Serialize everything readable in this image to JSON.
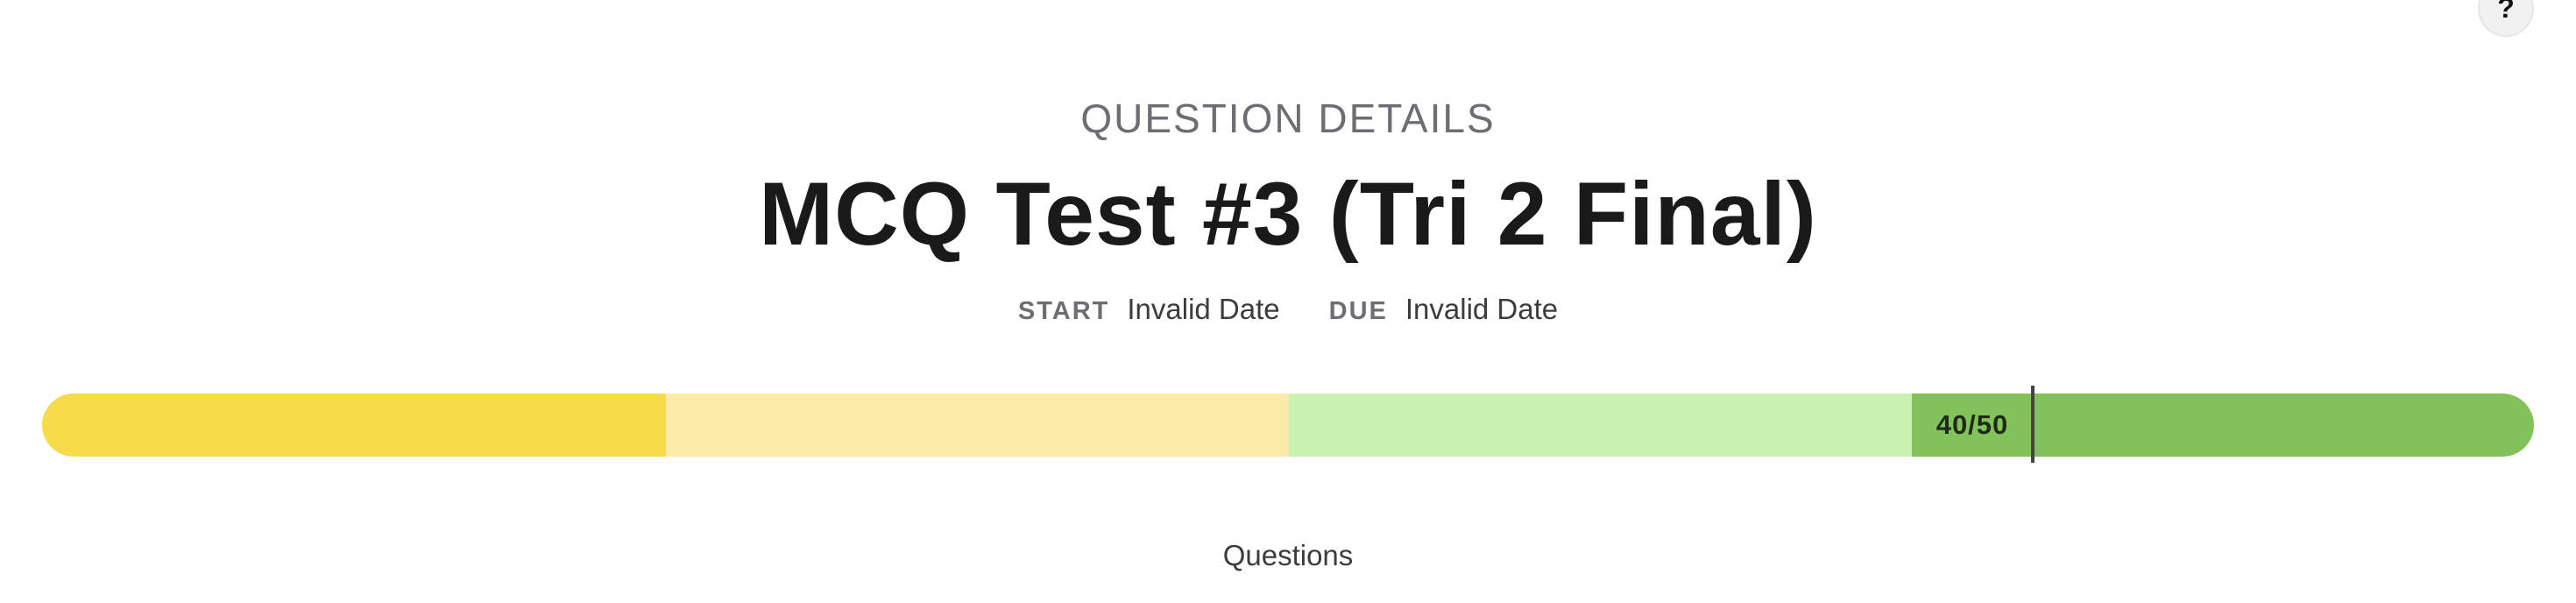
{
  "help": {
    "label": "?"
  },
  "header": {
    "section_label": "QUESTION DETAILS",
    "title": "MCQ Test #3 (Tri 2 Final)"
  },
  "dates": {
    "start_key": "START",
    "start_value": "Invalid Date",
    "due_key": "DUE",
    "due_value": "Invalid Date"
  },
  "progress": {
    "score_text": "40/50",
    "score": 40,
    "total": 50,
    "segments": [
      {
        "color": "#f7dc4a"
      },
      {
        "color": "#fbeaa8"
      },
      {
        "color": "#c9f2b1"
      },
      {
        "color": "#83c15b"
      }
    ]
  },
  "footer": {
    "questions_label": "Questions"
  }
}
